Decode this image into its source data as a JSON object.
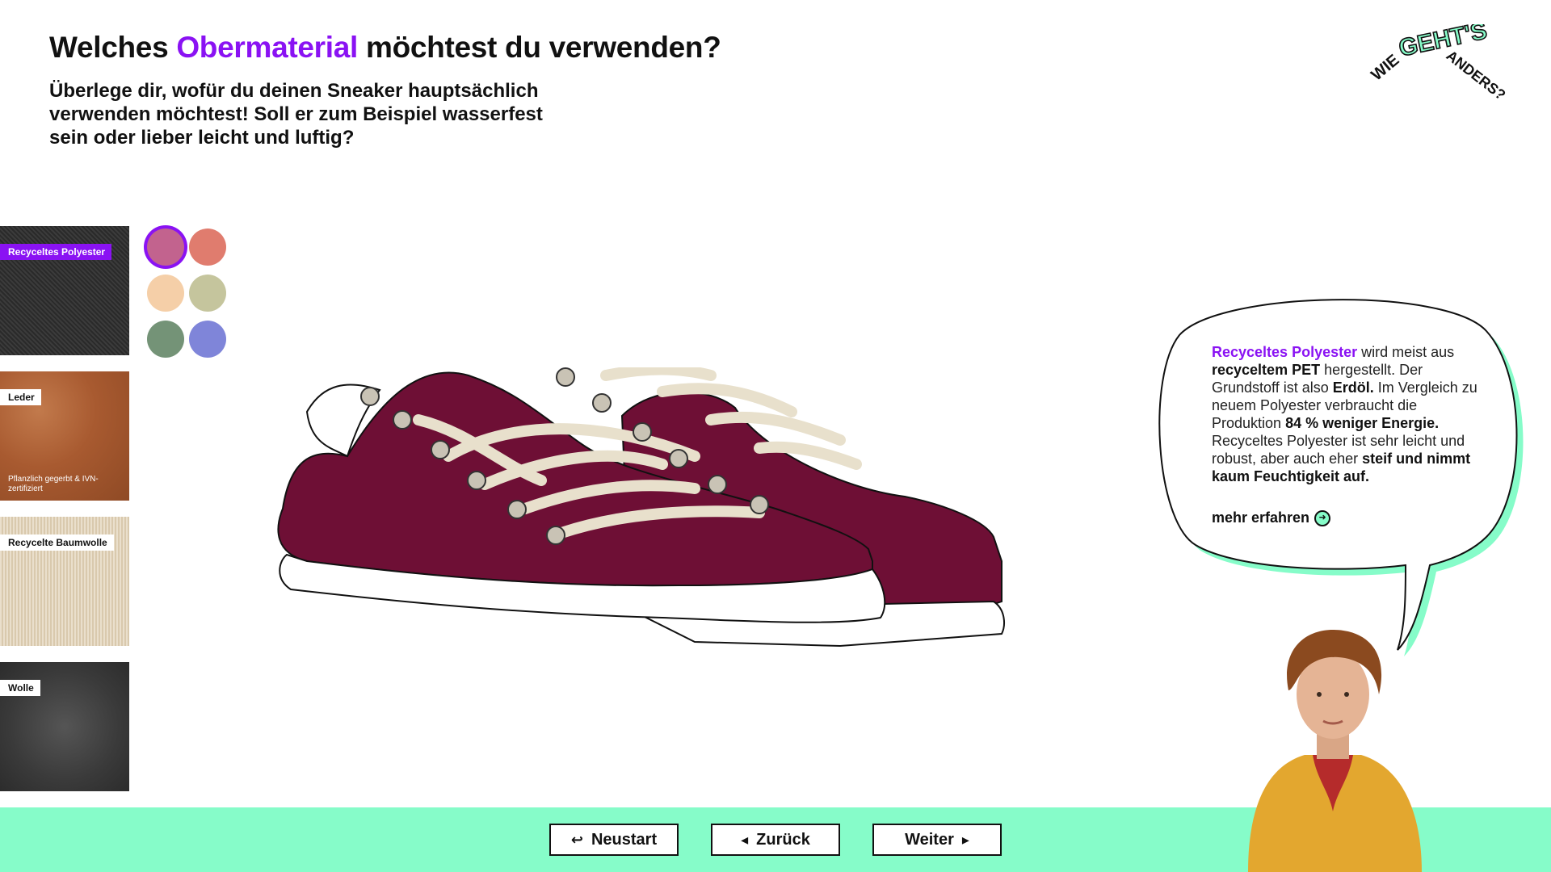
{
  "header": {
    "title_pre": "Welches ",
    "title_accent": "Obermaterial",
    "title_post": " möchtest du verwenden?",
    "subtitle": "Überlege dir, wofür du deinen Sneaker hauptsächlich verwenden möchtest! Soll er zum Beispiel wasserfest sein oder lieber leicht und luftig?"
  },
  "logo": {
    "word1": "WIE",
    "word2": "GEHT'S",
    "word3": "ANDERS?"
  },
  "materials": [
    {
      "label": "Recyceltes Polyester",
      "selected": true,
      "note": ""
    },
    {
      "label": "Leder",
      "selected": false,
      "note": "Pflanzlich gegerbt & IVN-zertifiziert"
    },
    {
      "label": "Recycelte Baumwolle",
      "selected": false,
      "note": ""
    },
    {
      "label": "Wolle",
      "selected": false,
      "note": ""
    }
  ],
  "colors": {
    "accent": "#8a12f3",
    "mint": "#86fcc9",
    "swatches": [
      "#c2638e",
      "#e07c6e",
      "#f5cfa8",
      "#c5c59d",
      "#749377",
      "#7f85d9"
    ],
    "selected_swatch": 0,
    "shoe_upper": "#6e0f35"
  },
  "info": {
    "material_name": "Recyceltes Polyester",
    "t1": " wird meist aus ",
    "b1": "recyceltem PET",
    "t2": " hergestellt. Der Grundstoff ist also ",
    "b2": "Erdöl.",
    "t3": " Im Vergleich zu neuem Polyester verbraucht die Produktion ",
    "b3": "84 % weniger Energie.",
    "t4": " Recyceltes Polyester ist sehr leicht und robust, aber auch eher ",
    "b4": "steif und nimmt kaum Feuchtigkeit auf.",
    "more": "mehr erfahren",
    "more_icon": "arrow-circle-icon"
  },
  "footer": {
    "restart": "Neustart",
    "back": "Zurück",
    "next": "Weiter"
  }
}
